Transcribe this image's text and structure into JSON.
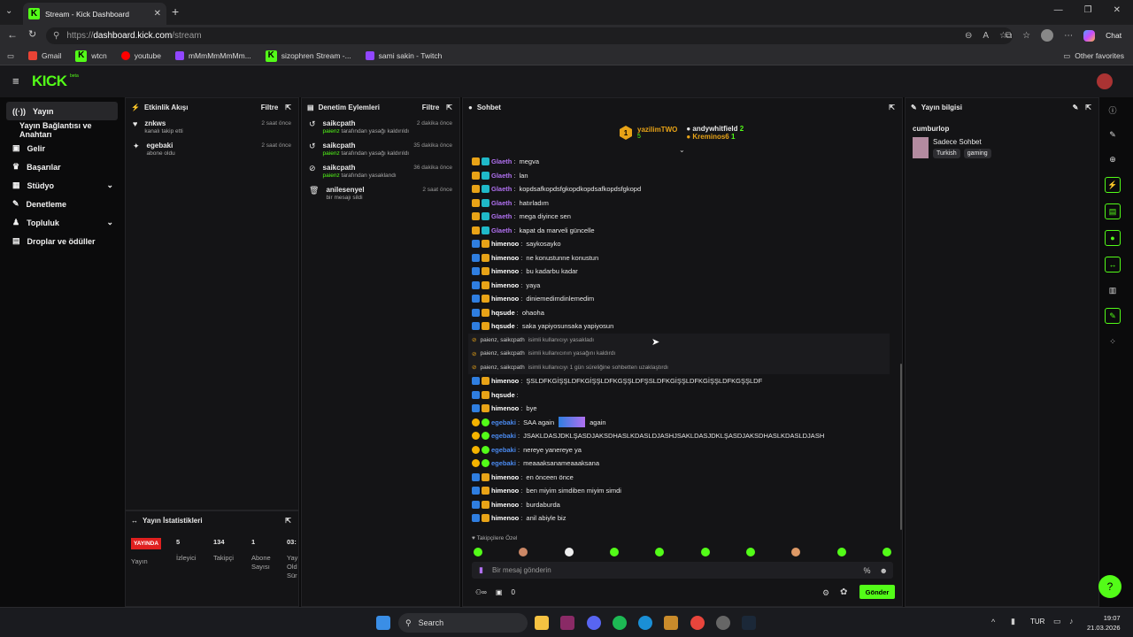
{
  "browser": {
    "tab_title": "Stream - Kick Dashboard",
    "url_prefix": "https://",
    "url_host": "dashboard.kick.com",
    "url_path": "/stream",
    "chat_label": "Chat",
    "bookmarks": [
      "Gmail",
      "wtcn",
      "youtube",
      "mMmMmMmMm...",
      "sizophren Stream -...",
      "sami sakin - Twitch"
    ],
    "other_favorites": "Other favorites"
  },
  "app": {
    "logo": "KICK",
    "logo_sup": "beta"
  },
  "sidebar": {
    "items": [
      {
        "label": "Yayın",
        "icon": "broadcast-icon"
      },
      {
        "label": "Yayın Bağlantısı ve Anahtarı",
        "icon": ""
      },
      {
        "label": "Gelir",
        "icon": "money-icon"
      },
      {
        "label": "Başarılar",
        "icon": "trophy-icon"
      },
      {
        "label": "Stüdyo",
        "icon": "studio-icon"
      },
      {
        "label": "Denetleme",
        "icon": "wrench-icon"
      },
      {
        "label": "Topluluk",
        "icon": "community-icon"
      },
      {
        "label": "Droplar ve ödüller",
        "icon": "gift-icon"
      }
    ]
  },
  "activity": {
    "title": "Etkinlik Akışı",
    "filter": "Filtre",
    "events": [
      {
        "name": "znkws",
        "desc": "kanalı takip etti",
        "time": "2 saat önce"
      },
      {
        "name": "egebaki",
        "desc": "abone oldu",
        "time": "2 saat önce"
      }
    ]
  },
  "moderation": {
    "title": "Denetim Eylemleri",
    "filter": "Filtre",
    "events": [
      {
        "name": "saikcpath",
        "mod": "paienz",
        "desc": "tarafından yasağı kaldırıldı",
        "time": "2 dakika önce"
      },
      {
        "name": "saikcpath",
        "mod": "paienz",
        "desc": "tarafından yasağı kaldırıldı",
        "time": "35 dakika önce"
      },
      {
        "name": "saikcpath",
        "mod": "paienz",
        "desc": "tarafından yasaklandı",
        "time": "36 dakika önce"
      },
      {
        "name": "anilesenyel",
        "mod": "",
        "desc": "bir mesajı sildi",
        "time": "2 saat önce"
      }
    ]
  },
  "stats": {
    "title": "Yayın İstatistikleri",
    "live_badge": "YAYINDA",
    "live_label": "Yayın",
    "items": [
      {
        "value": "5",
        "label": "İzleyici"
      },
      {
        "value": "134",
        "label": "Takipçi"
      },
      {
        "value": "1",
        "label": "Abone Sayısı"
      },
      {
        "value": "03:",
        "label": "Yay Old Sür"
      }
    ]
  },
  "chat": {
    "title": "Sohbet",
    "top": {
      "rank": "1",
      "leader": "yazilimTWO",
      "leader_count": "5",
      "user2": "andywhitfield",
      "user2_count": "2",
      "user3": "Kreminos6",
      "user3_count": "1"
    },
    "messages": [
      {
        "u": "Glaeth",
        "t": "megva",
        "c": "u1"
      },
      {
        "u": "Glaeth",
        "t": "lan",
        "c": "u1"
      },
      {
        "u": "Glaeth",
        "t": "kopdsafkopdsfgkopdkopdsafkopdsfgkopd",
        "c": "u1"
      },
      {
        "u": "Glaeth",
        "t": "hatırladım",
        "c": "u1"
      },
      {
        "u": "Glaeth",
        "t": "mega diyince sen",
        "c": "u1"
      },
      {
        "u": "Glaeth",
        "t": "kapat da marveli güncelle",
        "c": "u1"
      },
      {
        "u": "himenoo",
        "t": "saykosayko",
        "c": "u2"
      },
      {
        "u": "himenoo",
        "t": "ne konustunne konustun",
        "c": "u2"
      },
      {
        "u": "himenoo",
        "t": "bu kadarbu kadar",
        "c": "u2"
      },
      {
        "u": "himenoo",
        "t": "yaya",
        "c": "u2"
      },
      {
        "u": "himenoo",
        "t": "diniemedimdinlemedim",
        "c": "u2"
      },
      {
        "u": "hqsude",
        "t": "ohaoha",
        "c": "u2"
      },
      {
        "u": "hqsude",
        "t": "saka yapiyosunsaka yapiyosun",
        "c": "u2"
      }
    ],
    "system": [
      {
        "who": "paienz, saikcpath",
        "t": "isimli kullanıcıyı yasakladı"
      },
      {
        "who": "paienz, saikcpath",
        "t": "isimli kullanıcının yasağını kaldırdı"
      },
      {
        "who": "paienz, saikcpath",
        "t": "isimli kullanıcıyı 1 gün süreliğine sohbetten uzaklaştırdı"
      }
    ],
    "messages2": [
      {
        "u": "himenoo",
        "t": "ŞSLDFKGİŞŞLDFKGİŞŞLDFKGŞŞLDFŞSLDFKGİŞŞLDFKGİŞŞLDFKGŞŞLDF",
        "c": "u2"
      },
      {
        "u": "hqsude",
        "t": "",
        "c": "u2"
      },
      {
        "u": "himenoo",
        "t": "bye",
        "c": "u2"
      },
      {
        "u": "egebaki",
        "t": "SAA again",
        "t2": "again",
        "c": "u3"
      },
      {
        "u": "egebaki",
        "t": "JSAKLDASJDKLŞASDJAKSDHASLKDASLDJASHJSAKLDASJDKLŞASDJAKSDHASLKDASLDJASH",
        "c": "u3"
      },
      {
        "u": "egebaki",
        "t": "nereye yanereye ya",
        "c": "u3"
      },
      {
        "u": "egebaki",
        "t": "meaaaksanameaaaksana",
        "c": "u3"
      },
      {
        "u": "himenoo",
        "t": "en önceen önce",
        "c": "u2"
      },
      {
        "u": "himenoo",
        "t": "ben miyim simdiben miyim simdi",
        "c": "u2"
      },
      {
        "u": "himenoo",
        "t": "burdaburda",
        "c": "u2"
      },
      {
        "u": "himenoo",
        "t": "anil abiyle biz",
        "c": "u2"
      }
    ],
    "followers_only": "Takipçilere Özel",
    "input_placeholder": "Bir mesaj gönderin",
    "points": "0",
    "send": "Gönder"
  },
  "info": {
    "title": "Yayın bilgisi",
    "channel": "cumburlop",
    "stream_title": "Sadece Sohbet",
    "tags": [
      "Turkish",
      "gaming"
    ]
  },
  "taskbar": {
    "search": "Search",
    "lang": "TUR",
    "time": "19:07",
    "date": "21.03.2026"
  },
  "colors": {
    "accent": "#53fc18",
    "live": "#e0201f"
  }
}
